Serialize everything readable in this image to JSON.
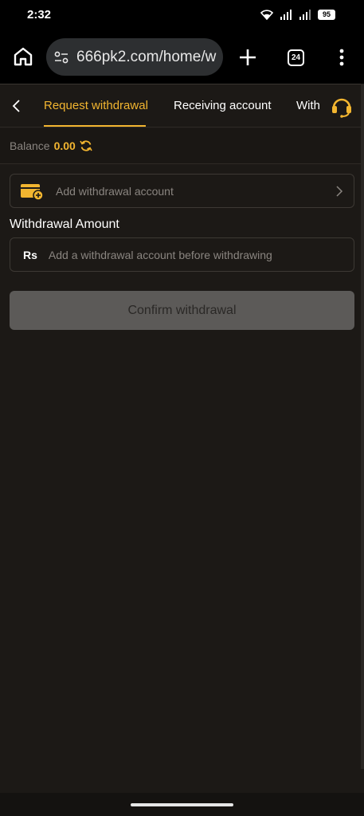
{
  "status_bar": {
    "time": "2:32",
    "battery": "95"
  },
  "browser": {
    "url": "666pk2.com/home/w",
    "tab_count": "24"
  },
  "header": {
    "tabs": [
      {
        "label": "Request withdrawal",
        "active": true
      },
      {
        "label": "Receiving account",
        "active": false
      },
      {
        "label": "With",
        "active": false
      }
    ]
  },
  "balance": {
    "label": "Balance",
    "value": "0.00"
  },
  "account": {
    "placeholder": "Add withdrawal account"
  },
  "amount": {
    "label": "Withdrawal Amount",
    "currency": "Rs",
    "placeholder": "Add a withdrawal account before withdrawing"
  },
  "actions": {
    "confirm_label": "Confirm withdrawal"
  },
  "colors": {
    "accent": "#f2b530",
    "background": "#1c1916",
    "disabled_button": "#5c5a58"
  }
}
